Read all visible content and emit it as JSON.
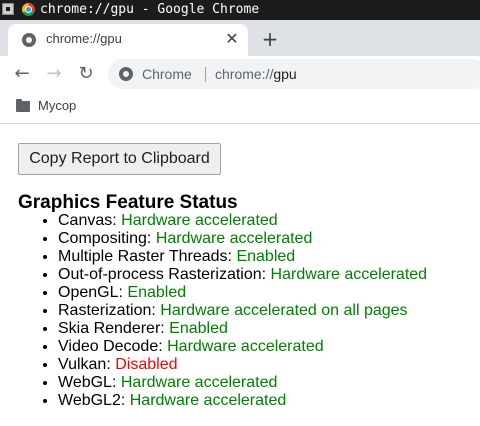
{
  "os_window": {
    "title": "chrome://gpu - Google Chrome",
    "menu_icon": "window-menu-icon",
    "app_icon": "chrome-logo-icon"
  },
  "tabs": [
    {
      "title": "chrome://gpu",
      "favicon": "chrome-page-icon",
      "close_icon": "close-icon",
      "close_glyph": "✕"
    }
  ],
  "new_tab": {
    "glyph": "+",
    "icon": "plus-icon"
  },
  "toolbar": {
    "back": {
      "glyph": "←",
      "icon": "back-arrow-icon"
    },
    "forward": {
      "glyph": "→",
      "icon": "forward-arrow-icon",
      "enabled": false
    },
    "reload": {
      "glyph": "↻",
      "icon": "reload-icon"
    },
    "omnibox": {
      "icon": "chrome-page-icon",
      "chip": "Chrome",
      "url_scheme": "chrome://",
      "url_host": "gpu"
    }
  },
  "bookmarks": [
    {
      "label": "Mycop",
      "icon": "folder-icon"
    }
  ],
  "content": {
    "copy_button": "Copy Report to Clipboard",
    "section_title": "Graphics Feature Status",
    "features": [
      {
        "name": "Canvas:",
        "status": "Hardware accelerated",
        "kind": "accel"
      },
      {
        "name": "Compositing:",
        "status": "Hardware accelerated",
        "kind": "accel"
      },
      {
        "name": "Multiple Raster Threads:",
        "status": "Enabled",
        "kind": "accel"
      },
      {
        "name": "Out-of-process Rasterization:",
        "status": "Hardware accelerated",
        "kind": "accel"
      },
      {
        "name": "OpenGL:",
        "status": "Enabled",
        "kind": "accel"
      },
      {
        "name": "Rasterization:",
        "status": "Hardware accelerated on all pages",
        "kind": "accel"
      },
      {
        "name": "Skia Renderer:",
        "status": "Enabled",
        "kind": "accel"
      },
      {
        "name": "Video Decode:",
        "status": "Hardware accelerated",
        "kind": "accel"
      },
      {
        "name": "Vulkan:",
        "status": "Disabled",
        "kind": "disabled"
      },
      {
        "name": "WebGL:",
        "status": "Hardware accelerated",
        "kind": "accel"
      },
      {
        "name": "WebGL2:",
        "status": "Hardware accelerated",
        "kind": "accel"
      }
    ]
  },
  "colors": {
    "status_enabled": "#008000",
    "status_disabled": "#ff0000",
    "os_titlebar": "#1c1c1c",
    "tabstrip": "#dee1e6"
  }
}
